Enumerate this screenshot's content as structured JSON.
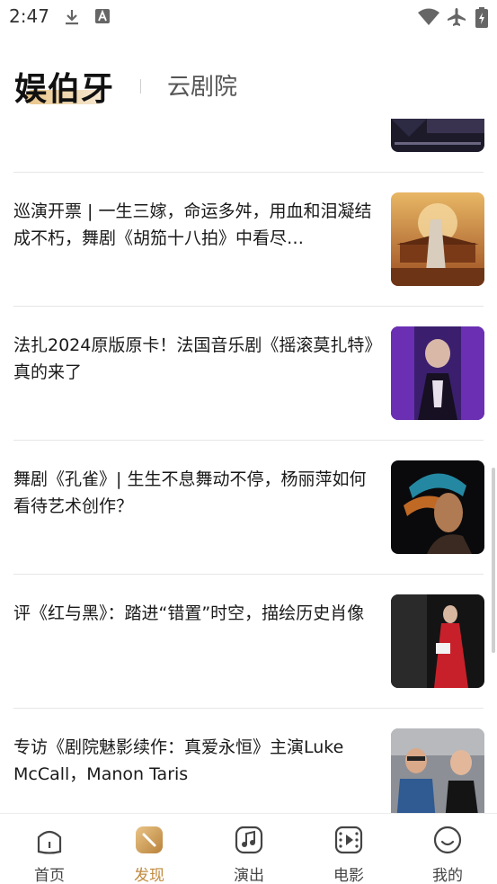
{
  "status_bar": {
    "time": "2:47",
    "icons": [
      "download-icon",
      "font-app-icon",
      "wifi-icon",
      "airplane-mode-icon",
      "battery-charging-icon"
    ]
  },
  "header": {
    "brand": "娱伯牙",
    "tab": "云剧院"
  },
  "articles": [
    {
      "title": "巡演开票 | 一生三嫁，命运多舛，用血和泪凝结成不朽，舞剧《胡笳十八拍》中看尽…",
      "thumb": "poster-ancient-palace"
    },
    {
      "title": "法扎2024原版原卡！法国音乐剧《摇滚莫扎特》真的来了",
      "thumb": "musical-stage-photo"
    },
    {
      "title": "舞剧《孔雀》| 生生不息舞动不停，杨丽萍如何看待艺术创作？",
      "thumb": "dancer-portrait"
    },
    {
      "title": "评《红与黑》：踏进“错置”时空，描绘历史肖像",
      "thumb": "red-dress-performer"
    },
    {
      "title": "专访《剧院魅影续作：真爱永恒》主演Luke McCall，Manon Taris",
      "thumb": "interview-photo"
    }
  ],
  "bottom_nav": [
    {
      "label": "首页",
      "icon": "home-icon",
      "active": false
    },
    {
      "label": "发现",
      "icon": "discover-icon",
      "active": true
    },
    {
      "label": "演出",
      "icon": "music-note-icon",
      "active": false
    },
    {
      "label": "电影",
      "icon": "film-icon",
      "active": false
    },
    {
      "label": "我的",
      "icon": "smile-profile-icon",
      "active": false
    }
  ],
  "colors": {
    "accent": "#c08a3e",
    "text": "#1a1a1a",
    "divider": "#e6e6e6"
  }
}
